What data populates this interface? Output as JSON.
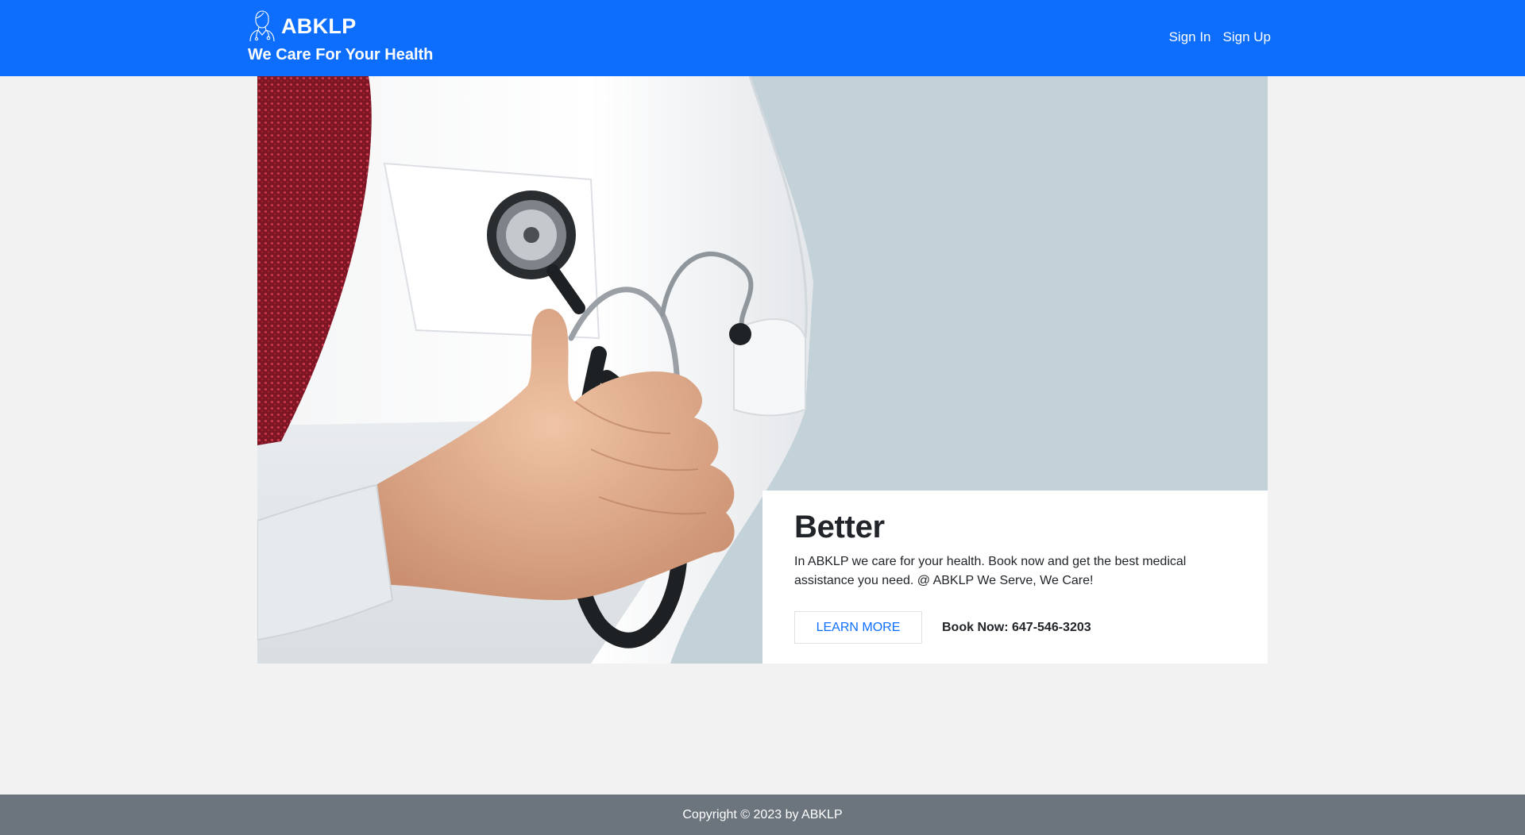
{
  "header": {
    "brand_name": "ABKLP",
    "tagline": "We Care For Your Health",
    "brand_icon": "doctor-outline-icon",
    "nav": [
      {
        "label": "Sign In"
      },
      {
        "label": "Sign Up"
      }
    ]
  },
  "hero": {
    "image_subject": "doctor-with-stethoscope-photo",
    "card": {
      "title": "Better",
      "text": "In ABKLP we care for your health. Book now and get the best medical assistance you need. @ ABKLP We Serve, We Care!",
      "button_label": "LEARN MORE",
      "book_now": "Book Now: 647-546-3203"
    }
  },
  "footer": {
    "copyright": "Copyright © 2023 by ABKLP"
  },
  "colors": {
    "primary": "#0d6efd",
    "footer": "#6c757d",
    "page_bg": "#f2f2f2",
    "hero_bg": "#c3d1d9"
  }
}
